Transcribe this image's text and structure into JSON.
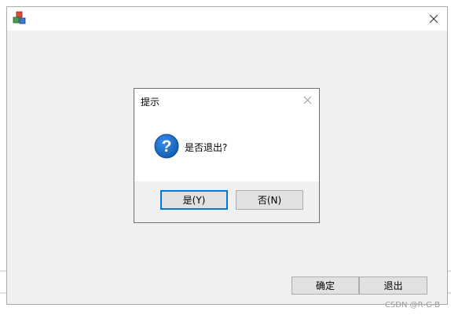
{
  "main_window": {
    "icon": "colored-blocks-app-icon",
    "close_icon": "close-icon",
    "buttons": {
      "ok": "确定",
      "exit": "退出"
    }
  },
  "dialog": {
    "title": "提示",
    "message": "是否退出?",
    "icon": "question-icon",
    "buttons": {
      "yes": "是(Y)",
      "no": "否(N)"
    }
  },
  "watermark": "CSDN @R-G-B",
  "colors": {
    "window_bg": "#f0f0f0",
    "focus_border": "#0078d7",
    "question_blue": "#1a6fc2"
  }
}
